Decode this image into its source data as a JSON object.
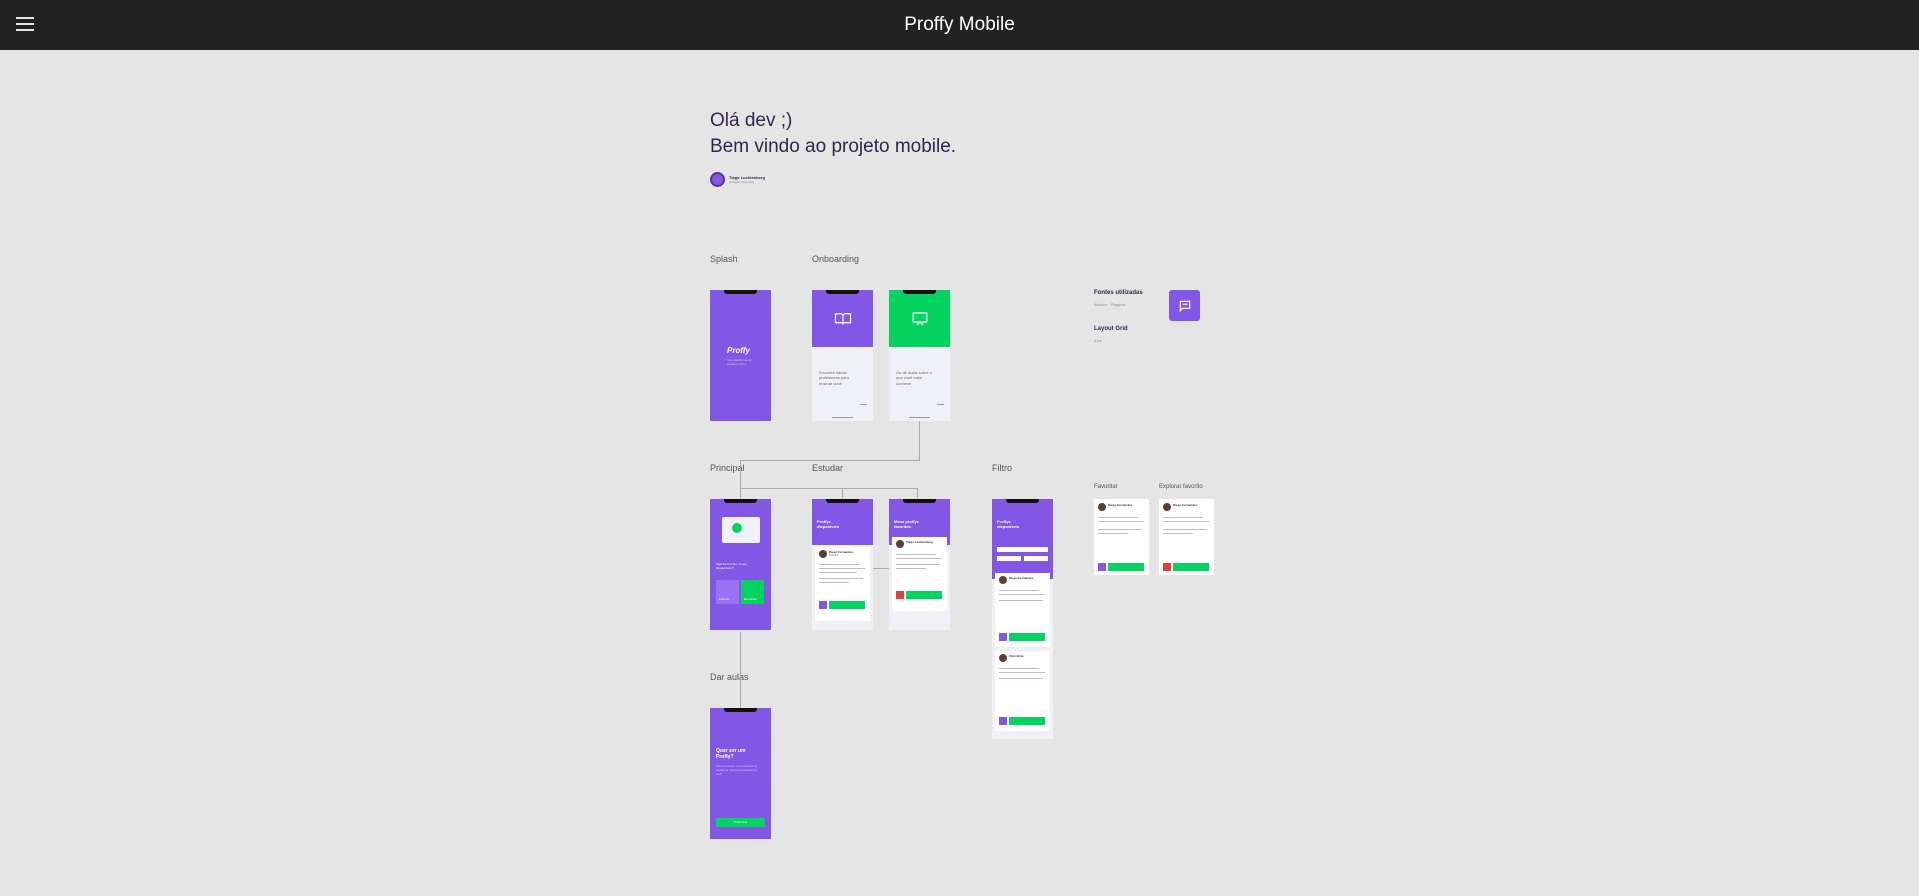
{
  "header": {
    "title": "Proffy Mobile",
    "menu_icon": "hamburger-menu-icon"
  },
  "intro": {
    "line1": "Olá dev ;)",
    "line2": "Bem vindo ao projeto mobile.",
    "author_name": "Tiago Luchtenberg",
    "author_handle": "@tiagoluchtenberg"
  },
  "sections": {
    "splash": "Splash",
    "onboarding": "Onboarding",
    "principal": "Principal",
    "estudar": "Estudar",
    "filtro": "Filtro",
    "dar_aulas": "Dar aulas",
    "favoritar": "Favoritar",
    "explorar_favorito": "Explorar favorito"
  },
  "resources": {
    "fonts_title": "Fontes utilizadas",
    "fonts_list": "Archivo · Poppins",
    "grid_title": "Layout Grid",
    "grid_value": "4 px"
  },
  "screens": {
    "splash_logo": "Proffy",
    "splash_tagline": "Sua plataforma de estudos online.",
    "onboarding1_text": "Encontre vários professores para ensinar você",
    "onboarding2_text": "Ou dê aulas sobre o que você mais conhece",
    "principal_text": "Seja bem-vindo. O que deseja fazer?",
    "principal_btn1": "Estudar",
    "principal_btn2": "Dar aulas",
    "estudar_title": "Proffys disponíveis",
    "favoritos_title": "Meus proffys favoritos",
    "filtro_title": "Proffys disponíveis",
    "teacher_name": "Diego Fernandes",
    "teacher_name2": "Tiago Luchtenberg",
    "teacher_name3": "Diego Fernandes",
    "teacher_name4": "Vitor Brito",
    "teacher_subject": "Química",
    "contact_btn": "Entrar em contato",
    "dar_aulas_title": "Quer ser um Proffy?",
    "dar_aulas_text": "Para começar, você precisa se cadastrar na nossa plataforma web.",
    "dar_aulas_btn": "Tudo bem"
  },
  "colors": {
    "primary": "#8257e5",
    "secondary": "#04d361",
    "topbar": "#222222",
    "canvas": "#e5e5e5"
  }
}
